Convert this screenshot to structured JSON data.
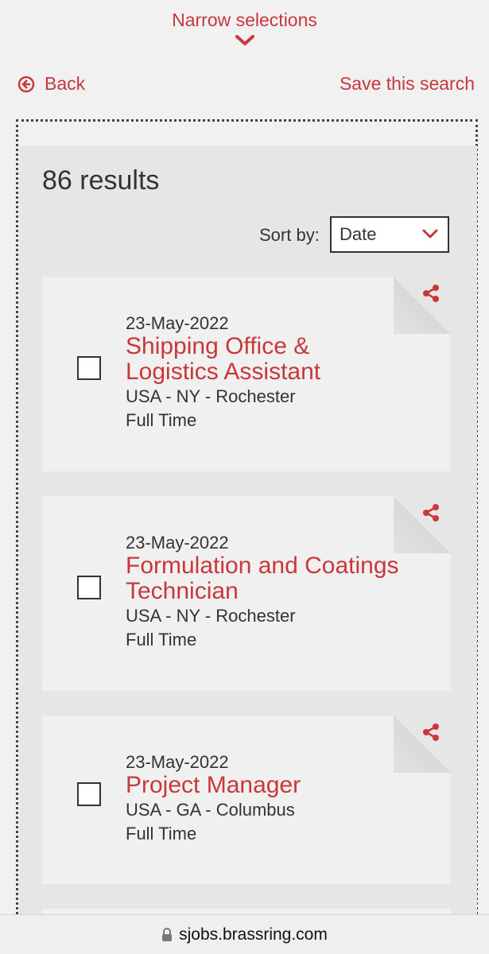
{
  "header": {
    "narrow_label": "Narrow selections",
    "back_label": "Back",
    "save_search_label": "Save this search"
  },
  "results": {
    "count_text": "86 results",
    "sort_label": "Sort by:",
    "sort_value": "Date"
  },
  "jobs": [
    {
      "date": "23-May-2022",
      "title_line1": "Shipping Office &",
      "title_line2": "Logistics Assistant",
      "location": "USA - NY - Rochester",
      "type": "Full Time"
    },
    {
      "date": "23-May-2022",
      "title_line1": "Formulation and Coatings",
      "title_line2": "Technician",
      "location": "USA - NY - Rochester",
      "type": "Full Time"
    },
    {
      "date": "23-May-2022",
      "title_line1": "Project Manager",
      "title_line2": "",
      "location": "USA - GA - Columbus",
      "type": "Full Time"
    }
  ],
  "browser": {
    "url": "sjobs.brassring.com"
  },
  "colors": {
    "accent": "#c8383b",
    "panel": "#e6e6e6",
    "card": "#f0f0f0"
  }
}
